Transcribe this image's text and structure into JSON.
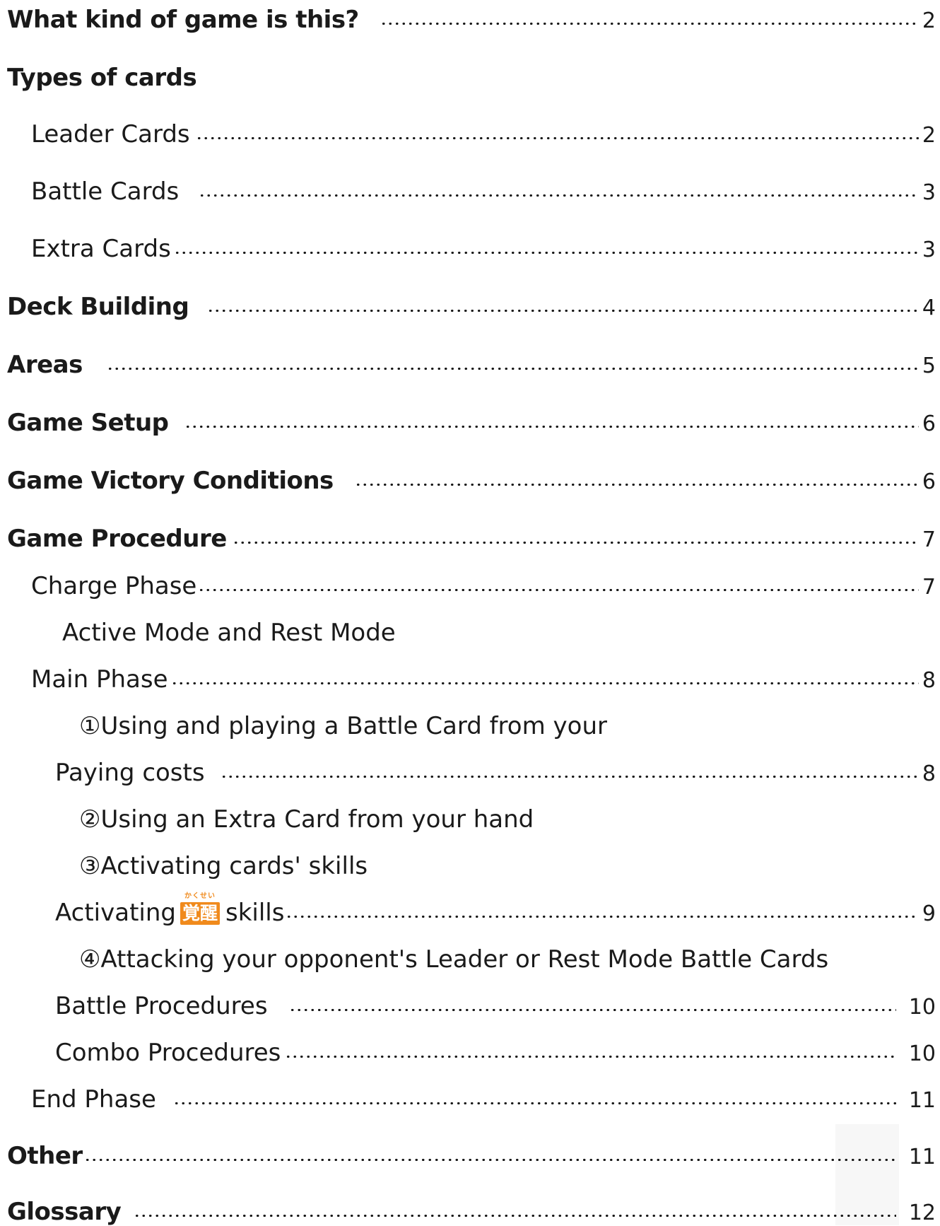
{
  "toc": {
    "what_kind": {
      "label": "What kind of game is this?",
      "page": "2"
    },
    "types_of_cards": {
      "label": "Types of cards"
    },
    "leader_cards": {
      "label": "Leader Cards",
      "page": "2"
    },
    "battle_cards": {
      "label": "Battle Cards",
      "page": "3"
    },
    "extra_cards": {
      "label": "Extra Cards",
      "page": "3"
    },
    "deck_building": {
      "label": "Deck Building",
      "page": "4"
    },
    "areas": {
      "label": "Areas",
      "page": "5"
    },
    "game_setup": {
      "label": "Game Setup",
      "page": "6"
    },
    "victory": {
      "label": "Game Victory Conditions",
      "page": "6"
    },
    "procedure": {
      "label": "Game Procedure",
      "page": "7"
    },
    "charge_phase": {
      "label": "Charge Phase",
      "page": "7"
    },
    "active_rest": {
      "label": "Active Mode and Rest Mode"
    },
    "main_phase": {
      "label": "Main Phase",
      "page": "8"
    },
    "using_battle": {
      "label": "①Using and playing a Battle Card from your"
    },
    "paying_costs": {
      "label": "Paying costs",
      "page": "8"
    },
    "using_extra": {
      "label": "②Using an Extra Card from your hand"
    },
    "activating_skills": {
      "label": "③Activating cards' skills"
    },
    "activating_awaken": {
      "label_before": "Activating",
      "badge": "覚醒",
      "badge_ruby": "かくせい",
      "label_after": "skills",
      "page": "9"
    },
    "attacking": {
      "label": "④Attacking your opponent's Leader or Rest Mode Battle Cards"
    },
    "battle_procedures": {
      "label": "Battle Procedures",
      "page": "10"
    },
    "combo_procedures": {
      "label": "Combo Procedures",
      "page": "10"
    },
    "end_phase": {
      "label": "End Phase",
      "page": "11"
    },
    "other": {
      "label": "Other",
      "page": "11"
    },
    "glossary": {
      "label": "Glossary",
      "page": "12"
    }
  },
  "colors": {
    "text": "#1a1a1a",
    "awaken_badge": "#f08a1c",
    "background": "#ffffff"
  }
}
